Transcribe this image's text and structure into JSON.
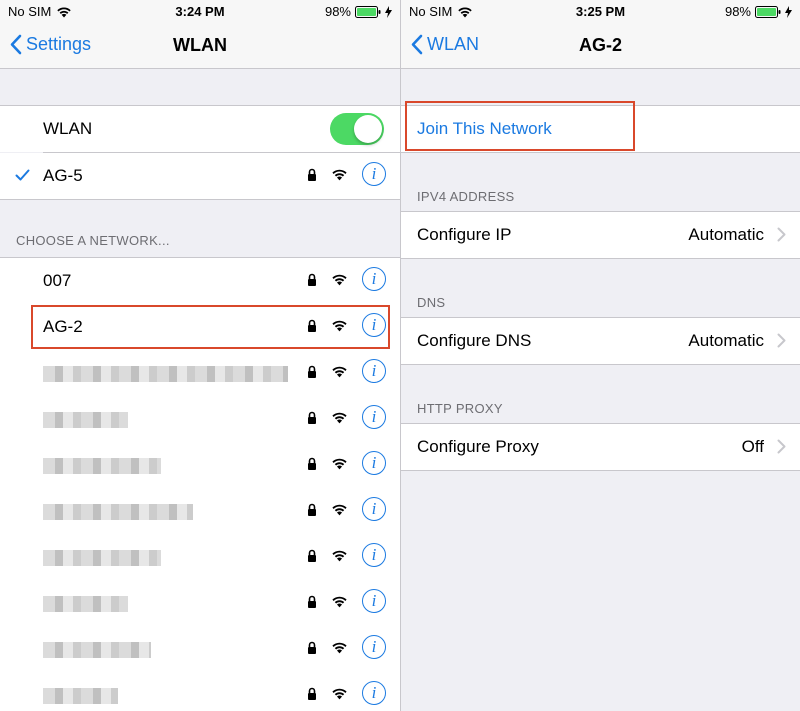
{
  "left": {
    "status": {
      "carrier": "No SIM",
      "time": "3:24 PM",
      "battery": "98%"
    },
    "nav": {
      "back_label": "Settings",
      "title": "WLAN"
    },
    "wlan_row": {
      "label": "WLAN",
      "toggle_on": true
    },
    "connected": {
      "name": "AG-5"
    },
    "choose_header": "CHOOSE A NETWORK...",
    "networks": [
      {
        "name": "007"
      },
      {
        "name": "AG-2"
      },
      {
        "name": ""
      },
      {
        "name": ""
      },
      {
        "name": ""
      },
      {
        "name": ""
      },
      {
        "name": ""
      },
      {
        "name": ""
      },
      {
        "name": ""
      },
      {
        "name": ""
      }
    ],
    "info_glyph": "i"
  },
  "right": {
    "status": {
      "carrier": "No SIM",
      "time": "3:25 PM",
      "battery": "98%"
    },
    "nav": {
      "back_label": "WLAN",
      "title": "AG-2"
    },
    "join_label": "Join This Network",
    "ipv4_header": "IPV4 ADDRESS",
    "configure_ip": {
      "label": "Configure IP",
      "value": "Automatic"
    },
    "dns_header": "DNS",
    "configure_dns": {
      "label": "Configure DNS",
      "value": "Automatic"
    },
    "proxy_header": "HTTP PROXY",
    "configure_proxy": {
      "label": "Configure Proxy",
      "value": "Off"
    }
  },
  "colors": {
    "accent": "#1b7ae1",
    "toggle_on": "#4cd964",
    "highlight": "#d9482b",
    "battery": "#4cd964"
  },
  "icons": [
    "wifi-icon",
    "lock-icon",
    "info-icon",
    "checkmark-icon",
    "chevron-left-icon",
    "chevron-right-icon",
    "battery-icon",
    "charging-bolt-icon"
  ]
}
